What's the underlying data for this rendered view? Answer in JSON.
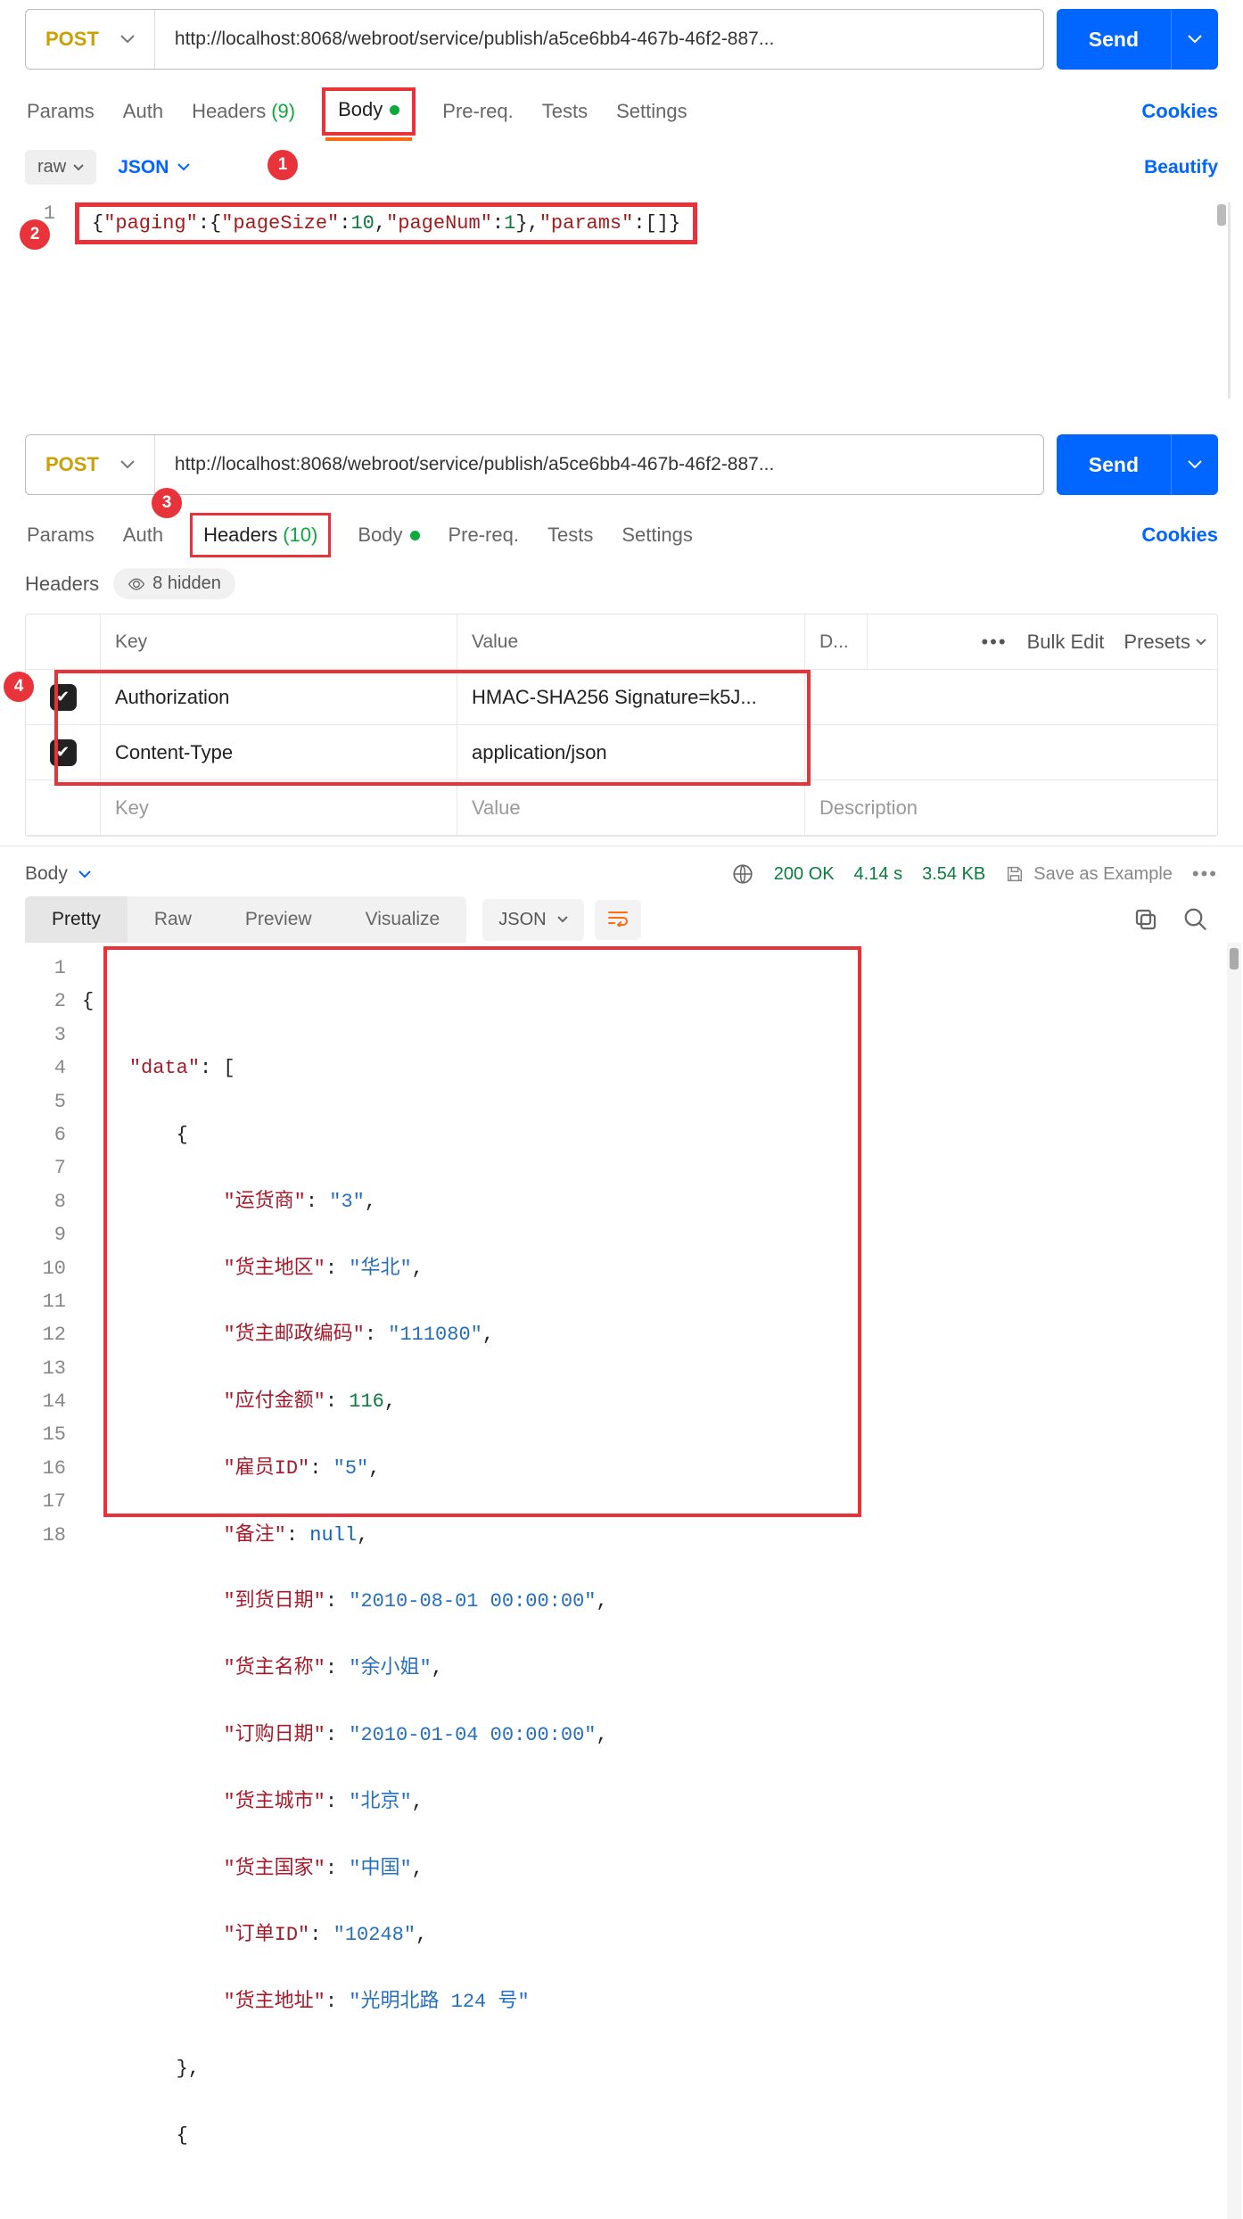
{
  "panel1": {
    "method": "POST",
    "url": "http://localhost:8068/webroot/service/publish/a5ce6bb4-467b-46f2-887...",
    "send_label": "Send",
    "tabs": {
      "params": "Params",
      "auth": "Auth",
      "headers_label": "Headers",
      "headers_count": "(9)",
      "body": "Body",
      "prereq": "Pre-req.",
      "tests": "Tests",
      "settings": "Settings"
    },
    "cookies": "Cookies",
    "raw_label": "raw",
    "json_label": "JSON",
    "beautify": "Beautify",
    "line_no": "1",
    "code_brace_open": "{",
    "code_k1": "\"paging\"",
    "code_k2": "\"pageSize\"",
    "code_v2": "10",
    "code_k3": "\"pageNum\"",
    "code_v3": "1",
    "code_k4": "\"params\"",
    "callout1": "1",
    "callout2": "2"
  },
  "panel2": {
    "method": "POST",
    "url": "http://localhost:8068/webroot/service/publish/a5ce6bb4-467b-46f2-887...",
    "send_label": "Send",
    "tabs": {
      "params": "Params",
      "auth": "Auth",
      "headers_label": "Headers",
      "headers_count": "(10)",
      "body": "Body",
      "prereq": "Pre-req.",
      "tests": "Tests",
      "settings": "Settings"
    },
    "cookies": "Cookies",
    "callout3": "3",
    "callout4": "4",
    "headers_section_label": "Headers",
    "hidden_count": "8 hidden",
    "th_key": "Key",
    "th_value": "Value",
    "th_desc_short": "D...",
    "bulk_edit": "Bulk Edit",
    "presets": "Presets",
    "rows": [
      {
        "key": "Authorization",
        "value": "HMAC-SHA256 Signature=k5J..."
      },
      {
        "key": "Content-Type",
        "value": "application/json"
      }
    ],
    "ph_key": "Key",
    "ph_value": "Value",
    "ph_desc": "Description"
  },
  "response": {
    "body_label": "Body",
    "status_code": "200",
    "status_text": "OK",
    "time": "4.14 s",
    "size": "3.54 KB",
    "save_example": "Save as Example",
    "rtabs": {
      "pretty": "Pretty",
      "raw": "Raw",
      "preview": "Preview",
      "visualize": "Visualize"
    },
    "fmt": "JSON",
    "gutter": [
      "1",
      "2",
      "3",
      "4",
      "5",
      "6",
      "7",
      "8",
      "9",
      "10",
      "11",
      "12",
      "13",
      "14",
      "15",
      "16",
      "17",
      "18"
    ],
    "kv": {
      "data": "\"data\"",
      "k1": "\"运货商\"",
      "v1": "\"3\"",
      "k2": "\"货主地区\"",
      "v2": "\"华北\"",
      "k3": "\"货主邮政编码\"",
      "v3": "\"111080\"",
      "k4": "\"应付金额\"",
      "v4n": "116",
      "k5": "\"雇员ID\"",
      "v5": "\"5\"",
      "k6": "\"备注\"",
      "v6null": "null",
      "k7": "\"到货日期\"",
      "v7": "\"2010-08-01 00:00:00\"",
      "k8": "\"货主名称\"",
      "v8": "\"余小姐\"",
      "k9": "\"订购日期\"",
      "v9": "\"2010-01-04 00:00:00\"",
      "k10": "\"货主城市\"",
      "v10": "\"北京\"",
      "k11": "\"货主国家\"",
      "v11": "\"中国\"",
      "k12": "\"订单ID\"",
      "v12": "\"10248\"",
      "k13": "\"货主地址\"",
      "v13": "\"光明北路 124 号\""
    }
  }
}
